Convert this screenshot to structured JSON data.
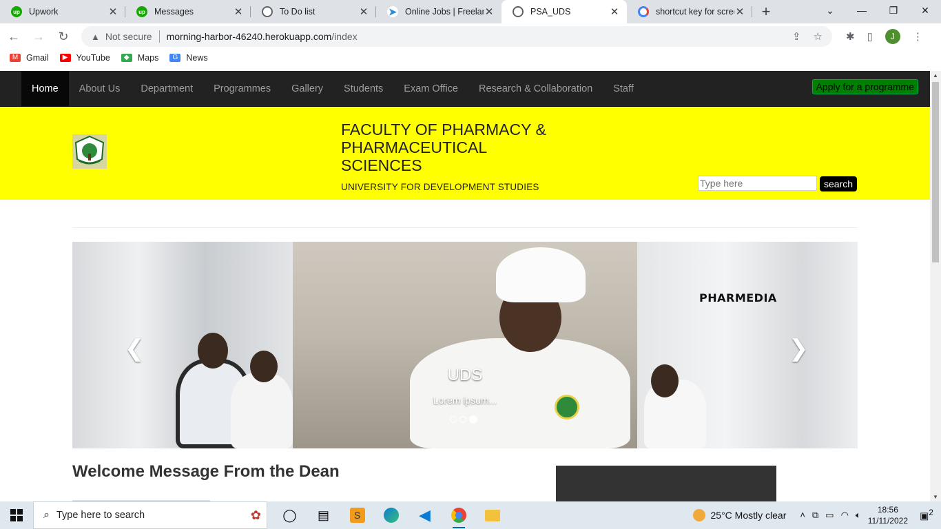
{
  "browser": {
    "tabs": [
      {
        "title": "Upwork",
        "favicon": "upwork-icon",
        "active": false
      },
      {
        "title": "Messages",
        "favicon": "upwork-icon",
        "active": false
      },
      {
        "title": "To Do list",
        "favicon": "globe-icon",
        "active": false
      },
      {
        "title": "Online Jobs | Freelanc",
        "favicon": "freelancer-icon",
        "active": false
      },
      {
        "title": "PSA_UDS",
        "favicon": "globe-icon",
        "active": true
      },
      {
        "title": "shortcut key for scree",
        "favicon": "google-icon",
        "active": false
      }
    ],
    "security_label": "Not secure",
    "url_host": "morning-harbor-46240.herokuapp.com",
    "url_path": "/index",
    "profile_initial": "J",
    "bookmarks": [
      {
        "label": "Gmail",
        "icon": "gmail-icon",
        "color": "#ea4335"
      },
      {
        "label": "YouTube",
        "icon": "youtube-icon",
        "color": "#ff0000"
      },
      {
        "label": "Maps",
        "icon": "maps-icon",
        "color": "#34a853"
      },
      {
        "label": "News",
        "icon": "news-icon",
        "color": "#4285f4"
      }
    ]
  },
  "site": {
    "nav": [
      {
        "label": "Home",
        "active": true
      },
      {
        "label": "About Us"
      },
      {
        "label": "Department"
      },
      {
        "label": "Programmes"
      },
      {
        "label": "Gallery"
      },
      {
        "label": "Students"
      },
      {
        "label": "Exam Office"
      },
      {
        "label": "Research & Collaboration"
      },
      {
        "label": "Staff"
      }
    ],
    "apply_label": "Apply for a programme",
    "faculty_title": "FACULTY OF PHARMACY & PHARMACEUTICAL SCIENCES",
    "university": "UNIVERSITY FOR DEVELOPMENT STUDIES",
    "search_placeholder": "Type here",
    "search_label": "search",
    "carousel": {
      "caption_title": "UDS",
      "caption_text": "Lorem ipsum...",
      "brand_text": "PHARMEDIA",
      "slide_count": 3,
      "active_slide": 3
    },
    "welcome_heading": "Welcome Message From the Dean"
  },
  "taskbar": {
    "search_placeholder": "Type here to search",
    "weather": "25°C  Mostly clear",
    "time": "18:56",
    "date": "11/11/2022",
    "notifications": "2",
    "apps": [
      "task-view-icon",
      "widgets-icon",
      "sublime-icon",
      "edge-icon",
      "vscode-icon",
      "chrome-icon",
      "file-explorer-icon"
    ]
  },
  "colors": {
    "banner": "#ffff00",
    "navbar": "#222222",
    "apply_button": "#008000"
  }
}
